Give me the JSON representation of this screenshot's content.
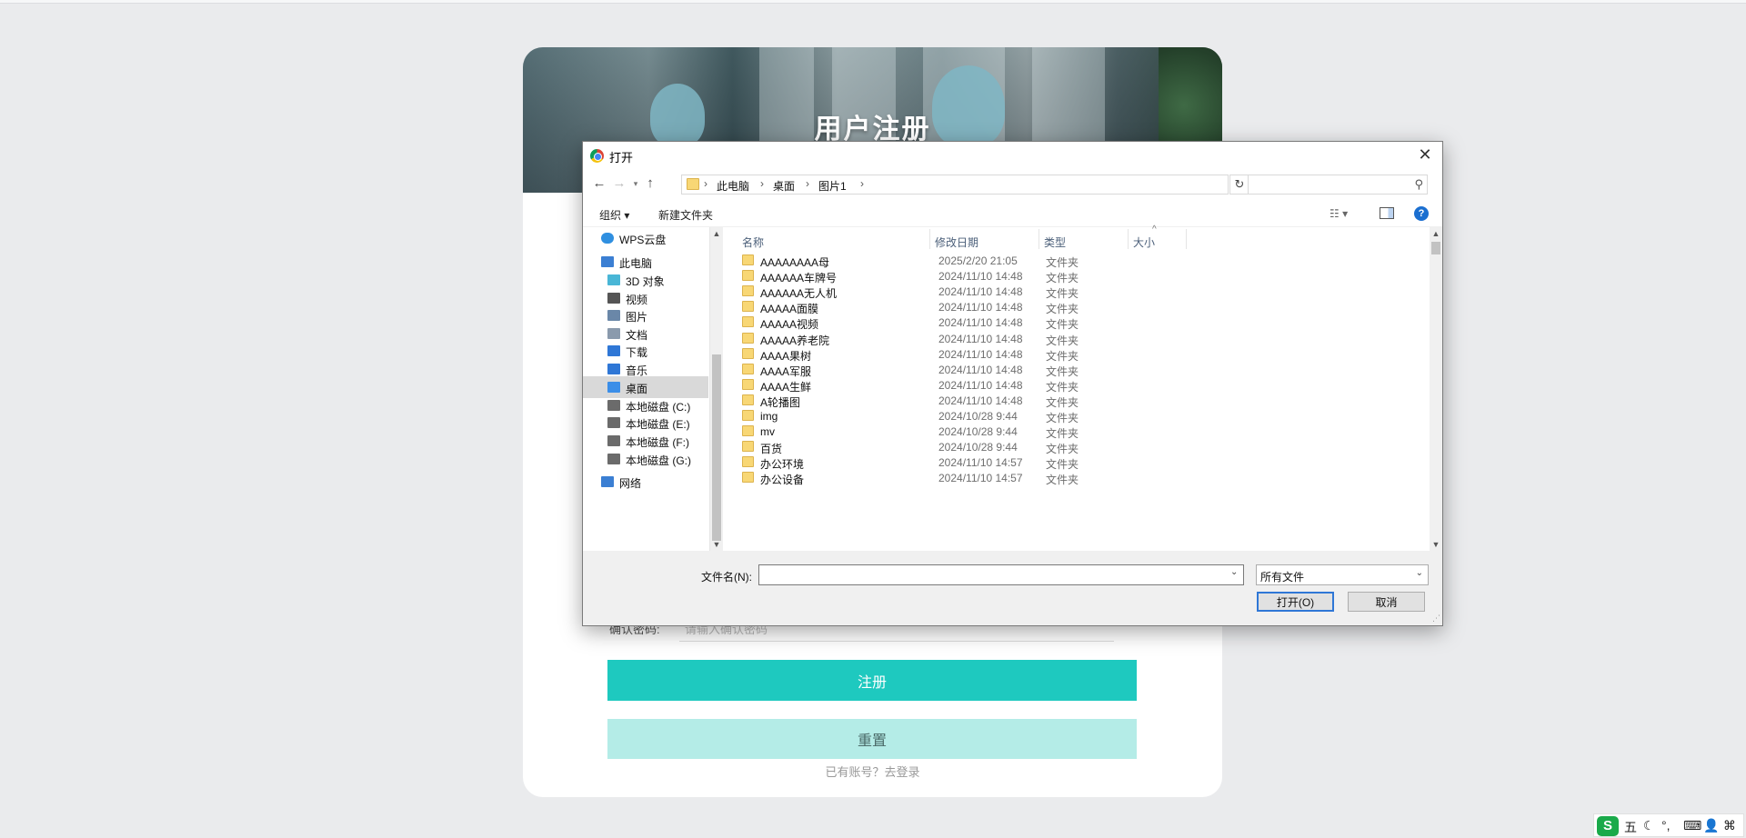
{
  "page": {
    "title": "用户注册",
    "field_label": "确认密码:",
    "field_placeholder": "请输入确认密码",
    "register_button": "注册",
    "reset_button": "重置",
    "login_link": "已有账号？去登录"
  },
  "dialog": {
    "title": "打开",
    "close_glyph": "✕",
    "breadcrumbs": [
      "此电脑",
      "桌面",
      "图片1"
    ],
    "search_placeholder": "",
    "toolbar": {
      "organize": "组织 ▾",
      "new_folder": "新建文件夹"
    },
    "nav_items": [
      {
        "label": "WPS云盘",
        "icon": "cloud-icon"
      },
      {
        "label": "此电脑",
        "icon": "computer-icon"
      },
      {
        "label": "3D 对象",
        "icon": "cube-icon"
      },
      {
        "label": "视频",
        "icon": "video-icon"
      },
      {
        "label": "图片",
        "icon": "picture-icon"
      },
      {
        "label": "文档",
        "icon": "document-icon"
      },
      {
        "label": "下载",
        "icon": "download-icon"
      },
      {
        "label": "音乐",
        "icon": "music-icon"
      },
      {
        "label": "桌面",
        "icon": "desktop-icon",
        "selected": true
      },
      {
        "label": "本地磁盘 (C:)",
        "icon": "drive-icon"
      },
      {
        "label": "本地磁盘 (E:)",
        "icon": "drive-icon"
      },
      {
        "label": "本地磁盘 (F:)",
        "icon": "drive-icon"
      },
      {
        "label": "本地磁盘 (G:)",
        "icon": "drive-icon"
      },
      {
        "label": "网络",
        "icon": "network-icon"
      }
    ],
    "columns": {
      "name": "名称",
      "date": "修改日期",
      "type": "类型",
      "size": "大小"
    },
    "files": [
      {
        "name": "AAAAAAAA母",
        "date": "2025/2/20 21:05",
        "type": "文件夹"
      },
      {
        "name": "AAAAAA车牌号",
        "date": "2024/11/10 14:48",
        "type": "文件夹"
      },
      {
        "name": "AAAAAA无人机",
        "date": "2024/11/10 14:48",
        "type": "文件夹"
      },
      {
        "name": "AAAAA面膜",
        "date": "2024/11/10 14:48",
        "type": "文件夹"
      },
      {
        "name": "AAAAA视频",
        "date": "2024/11/10 14:48",
        "type": "文件夹"
      },
      {
        "name": "AAAAA养老院",
        "date": "2024/11/10 14:48",
        "type": "文件夹"
      },
      {
        "name": "AAAA果树",
        "date": "2024/11/10 14:48",
        "type": "文件夹"
      },
      {
        "name": "AAAA军服",
        "date": "2024/11/10 14:48",
        "type": "文件夹"
      },
      {
        "name": "AAAA生鲜",
        "date": "2024/11/10 14:48",
        "type": "文件夹"
      },
      {
        "name": "A轮播图",
        "date": "2024/11/10 14:48",
        "type": "文件夹"
      },
      {
        "name": "img",
        "date": "2024/10/28 9:44",
        "type": "文件夹"
      },
      {
        "name": "mv",
        "date": "2024/10/28 9:44",
        "type": "文件夹"
      },
      {
        "name": "百货",
        "date": "2024/10/28 9:44",
        "type": "文件夹"
      },
      {
        "name": "办公环境",
        "date": "2024/11/10 14:57",
        "type": "文件夹"
      },
      {
        "name": "办公设备",
        "date": "2024/11/10 14:57",
        "type": "文件夹"
      }
    ],
    "filename_label": "文件名(N):",
    "filename_value": "",
    "filter_value": "所有文件",
    "open_button": "打开(O)",
    "cancel_button": "取消"
  },
  "ime": {
    "mode": "五",
    "logo": "S"
  },
  "colors": {
    "accent": "#1ec9bf",
    "reset_bg": "#b4ece7",
    "focus": "#2f77d6"
  }
}
